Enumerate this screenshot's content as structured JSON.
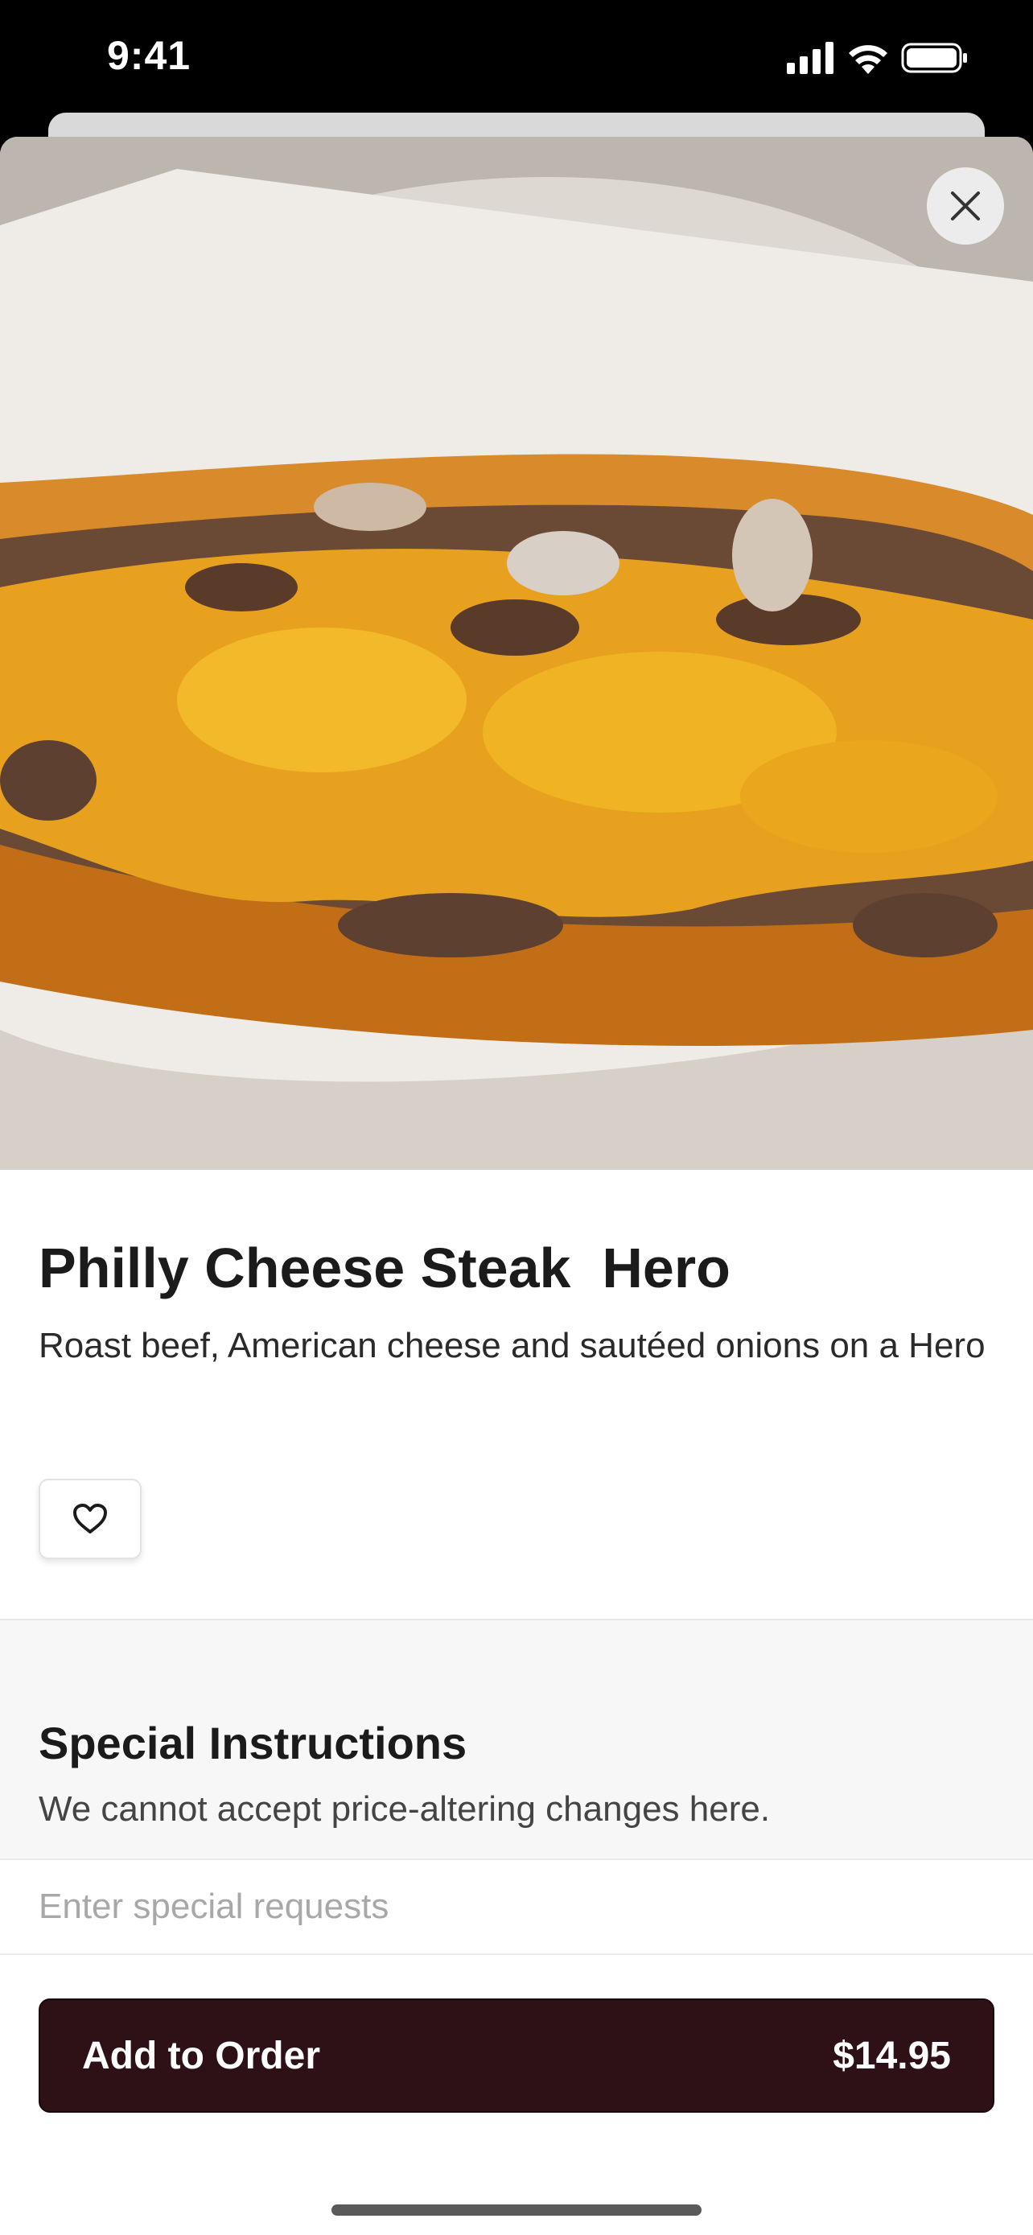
{
  "status_bar": {
    "time": "9:41"
  },
  "icons": {
    "signal": "cellular-signal-icon",
    "wifi": "wifi-icon",
    "battery": "battery-icon",
    "close": "close-icon",
    "favorite": "heart-icon"
  },
  "item": {
    "title": "Philly Cheese Steak  Hero",
    "description": "Roast beef, American cheese and sautéed onions on a Hero"
  },
  "special_instructions": {
    "title": "Special Instructions",
    "subtitle": "We cannot accept price-altering changes here.",
    "placeholder": "Enter special requests",
    "value": ""
  },
  "order": {
    "button_label": "Add to Order",
    "price": "$14.95"
  },
  "colors": {
    "primary_button": "#2d1117",
    "section_background": "#f7f7f7",
    "text": "#1b1b1b"
  }
}
